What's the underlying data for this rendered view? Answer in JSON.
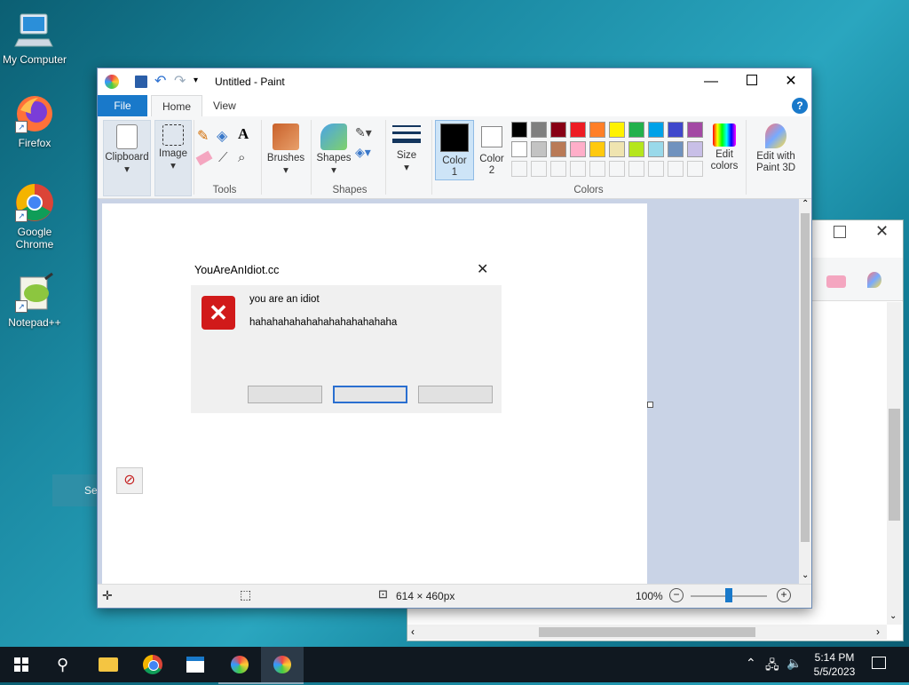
{
  "desktop": {
    "icons": [
      {
        "label": "My Computer",
        "icon": "computer-icon"
      },
      {
        "label": "Firefox",
        "icon": "firefox-icon"
      },
      {
        "label": "Google Chrome",
        "icon": "chrome-icon"
      },
      {
        "label": "Notepad++",
        "icon": "notepadpp-icon"
      }
    ],
    "partial_text": "Set"
  },
  "paint": {
    "title": "Untitled - Paint",
    "tabs": [
      "File",
      "Home",
      "View"
    ],
    "ribbon": {
      "clipboard": "Clipboard",
      "image": "Image",
      "tools": "Tools",
      "brushes": "Brushes",
      "shapes_btn": "Shapes",
      "shapes_group": "Shapes",
      "size": "Size",
      "color1": "Color 1",
      "color2": "Color 2",
      "colors_group": "Colors",
      "edit_colors": "Edit colors",
      "edit_paint3d": "Edit with Paint 3D"
    },
    "palette_row1": [
      "#000000",
      "#7f7f7f",
      "#880015",
      "#ed1c24",
      "#ff7f27",
      "#fff200",
      "#22b14c",
      "#00a2e8",
      "#3f48cc",
      "#a349a4"
    ],
    "palette_row2": [
      "#ffffff",
      "#c3c3c3",
      "#b97a57",
      "#ffaec9",
      "#ffc90e",
      "#efe4b0",
      "#b5e61d",
      "#99d9ea",
      "#7092be",
      "#c8bfe7"
    ],
    "status": {
      "dimensions": "614 × 460px",
      "zoom": "100%"
    }
  },
  "dialog": {
    "title": "YouAreAnIdiot.cc",
    "line1": "you are an idiot",
    "line2": "hahahahahahahahahahahahaha"
  },
  "taskbar": {
    "time": "5:14 PM",
    "date": "5/5/2023"
  }
}
